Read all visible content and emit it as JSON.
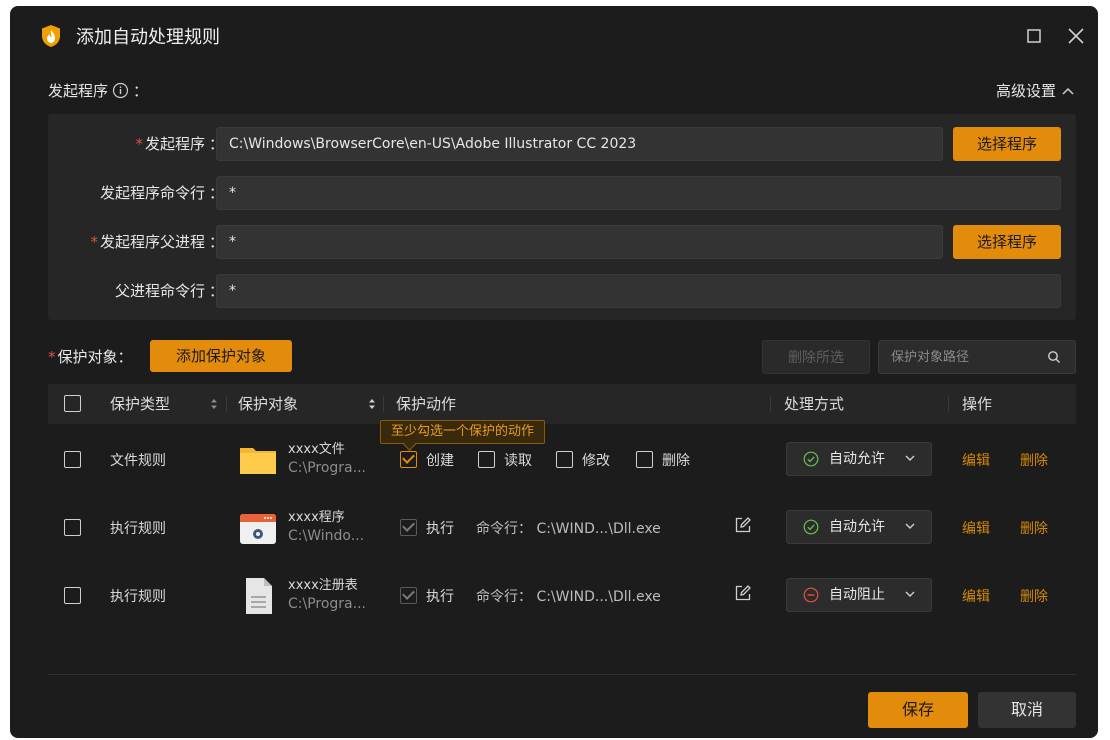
{
  "window": {
    "title": "添加自动处理规则"
  },
  "section": {
    "initiator_label": "发起程序",
    "initiator_suffix": "：",
    "advanced_label": "高级设置"
  },
  "form": {
    "initiator": {
      "label": "发起程序",
      "value": "C:\\Windows\\BrowserCore\\en-US\\Adobe Illustrator CC 2023",
      "button": "选择程序"
    },
    "initiator_cmd": {
      "label": "发起程序命令行",
      "value": "*"
    },
    "parent": {
      "label": "发起程序父进程",
      "value": "*",
      "button": "选择程序"
    },
    "parent_cmd": {
      "label": "父进程命令行",
      "value": "*"
    },
    "colon": "："
  },
  "protect": {
    "label": "保护对象：",
    "add_button": "添加保护对象",
    "delete_selected": "删除所选",
    "search_placeholder": "保护对象路径"
  },
  "table": {
    "headers": {
      "type": "保护类型",
      "object": "保护对象",
      "action": "保护动作",
      "method": "处理方式",
      "ops": "操作"
    },
    "tooltip": "至少勾选一个保护的动作",
    "rows": [
      {
        "type": "文件规则",
        "icon": "folder-icon",
        "name": "xxxx文件",
        "path": "C:\\Progra...",
        "actions": [
          {
            "label": "创建",
            "checked": true
          },
          {
            "label": "读取",
            "checked": false
          },
          {
            "label": "修改",
            "checked": false
          },
          {
            "label": "删除",
            "checked": false
          }
        ],
        "method": "自动允许",
        "method_status": "allow",
        "edit": "编辑",
        "delete": "删除"
      },
      {
        "type": "执行规则",
        "icon": "program-window-icon",
        "name": "xxxx程序",
        "path": "C:\\Windo...",
        "actions": [
          {
            "label": "执行",
            "checked": true,
            "disabled": true
          }
        ],
        "cmd": "命令行：  C:\\WIND...\\Dll.exe",
        "method": "自动允许",
        "method_status": "allow",
        "edit": "编辑",
        "delete": "删除"
      },
      {
        "type": "执行规则",
        "icon": "registry-file-icon",
        "name": "xxxx注册表",
        "path": "C:\\Progra...",
        "actions": [
          {
            "label": "执行",
            "checked": true,
            "disabled": true
          }
        ],
        "cmd": "命令行：  C:\\WIND...\\Dll.exe",
        "method": "自动阻止",
        "method_status": "block",
        "edit": "编辑",
        "delete": "删除"
      }
    ]
  },
  "footer": {
    "save": "保存",
    "cancel": "取消"
  },
  "colors": {
    "accent": "#e38b0a",
    "allow": "#6abf4b",
    "block": "#e0533d",
    "background": "#1c1c1c"
  }
}
